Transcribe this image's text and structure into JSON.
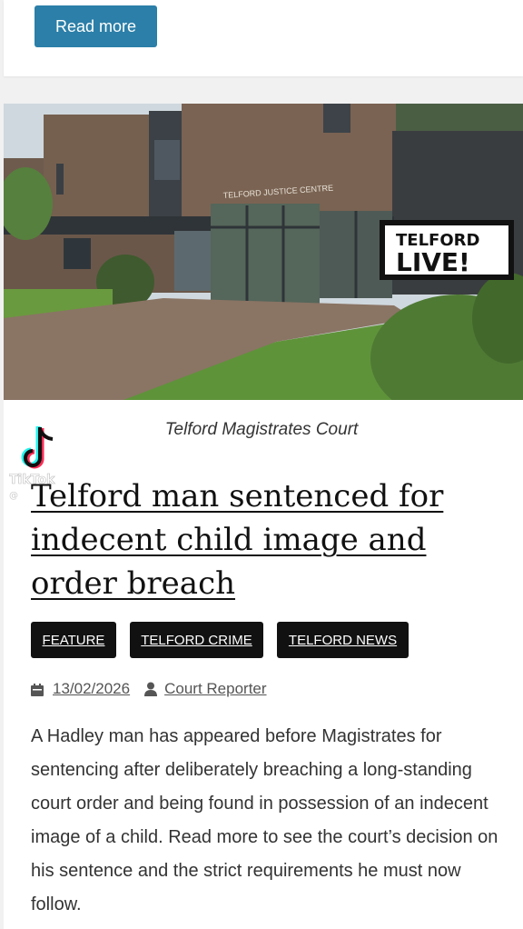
{
  "top_card": {
    "read_more_label": "Read more"
  },
  "article": {
    "image": {
      "building_sign": "TELFORD JUSTICE CENTRE",
      "logo_line1": "TELFORD",
      "logo_line2": "LIVE!"
    },
    "caption": "Telford Magistrates Court",
    "tiktok": {
      "brand": "TikTok",
      "handle": "@"
    },
    "title": "Telford man sentenced for indecent child image and order breach",
    "tags": [
      "FEATURE",
      "TELFORD CRIME",
      "TELFORD NEWS"
    ],
    "date": "13/02/2026",
    "author": "Court Reporter",
    "excerpt": "A Hadley man has appeared before Magistrates for sentencing after deliberately breaching a long-standing court order and being found in possession of an indecent image of a child. Read more to see the court’s decision on his sentence and the strict requirements he must now follow."
  },
  "colors": {
    "button": "#2b7fa8",
    "tag_bg": "#111111",
    "meta": "#555555"
  }
}
